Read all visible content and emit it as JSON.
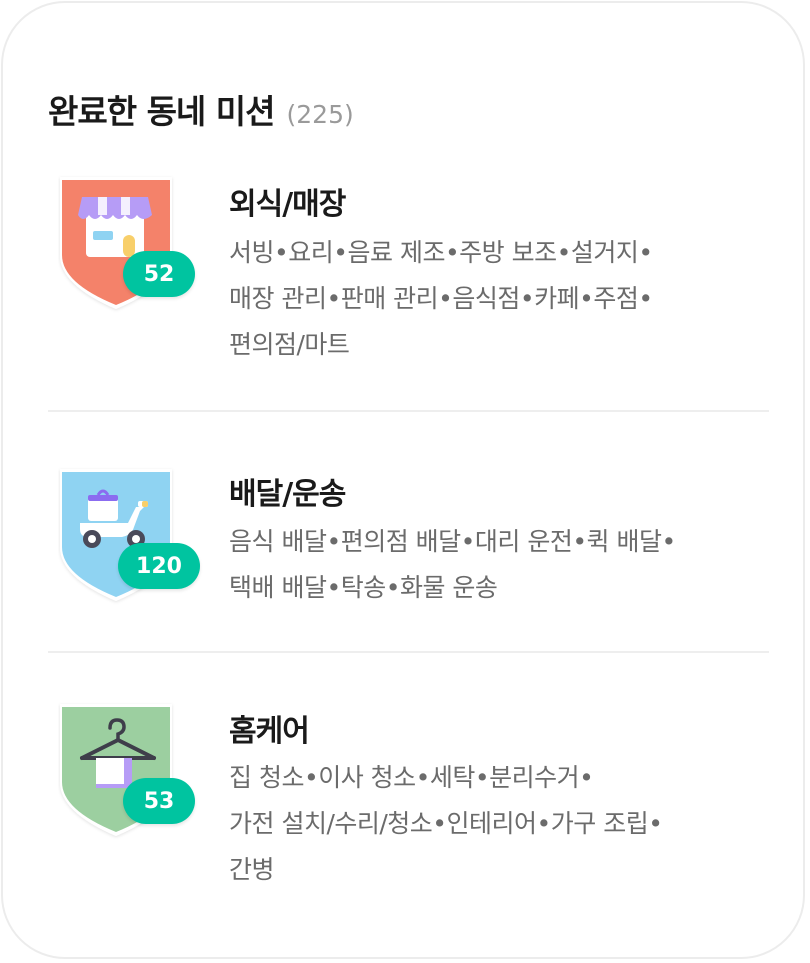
{
  "header": {
    "title": "완료한 동네 미션",
    "count": "(225)"
  },
  "sections": [
    {
      "title": "외식/매장",
      "badge_count": "52",
      "badge_color": "#f4826a",
      "icon": "storefront-icon",
      "description_lines": [
        "서빙•요리•음료 제조•주방 보조•설거지•",
        "매장 관리•판매 관리•음식점•카페•주점•",
        "편의점/마트"
      ]
    },
    {
      "title": "배달/운송",
      "badge_count": "120",
      "badge_color": "#8fd3f2",
      "icon": "delivery-scooter-icon",
      "description_lines": [
        "음식 배달•편의점 배달•대리 운전•퀵 배달•",
        "택배 배달•탁송•화물 운송"
      ]
    },
    {
      "title": "홈케어",
      "badge_count": "53",
      "badge_color": "#9ccfa0",
      "icon": "hanger-towel-icon",
      "description_lines": [
        "집 청소•이사 청소•세탁•분리수거•",
        "가전 설치/수리/청소•인테리어•가구 조립•",
        "간병"
      ]
    }
  ],
  "colors": {
    "count_pill": "#00c4a0",
    "title_text": "#1a1a1a",
    "description_text": "#6b6b6b",
    "count_text": "#9a9a9a",
    "divider": "#eeeeee"
  }
}
